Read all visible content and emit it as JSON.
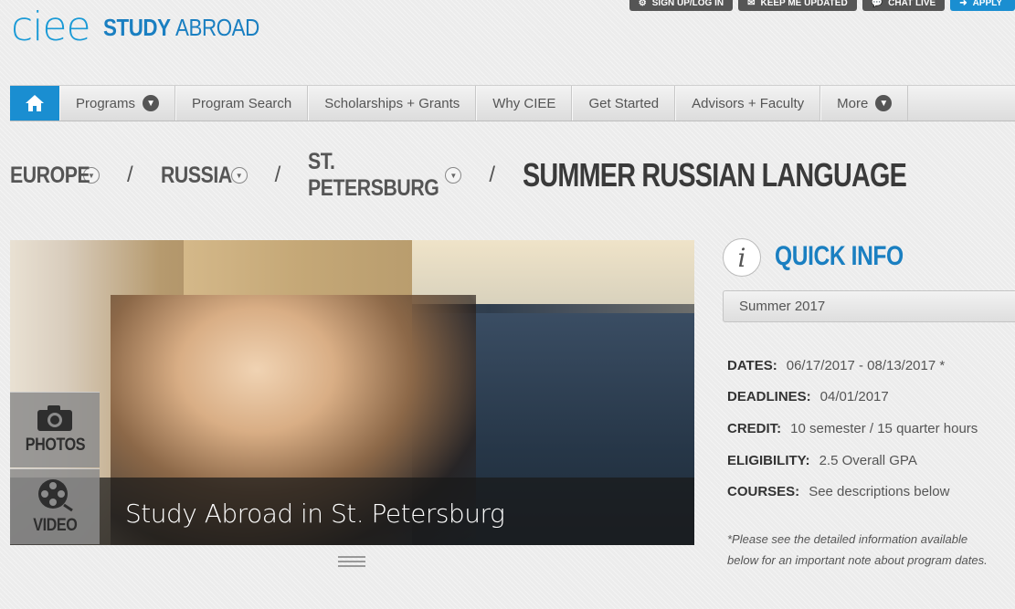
{
  "brand": {
    "logo_mark": "ciee",
    "logo_text_1": "STUDY",
    "logo_text_2": "ABROAD"
  },
  "toplinks": [
    {
      "label": "SIGN UP/LOG IN",
      "icon": "gear-icon"
    },
    {
      "label": "KEEP ME UPDATED",
      "icon": "mail-icon"
    },
    {
      "label": "CHAT LIVE",
      "icon": "chat-icon"
    },
    {
      "label": "APPLY",
      "icon": "arrow-icon"
    }
  ],
  "nav": {
    "home_icon": "home-icon",
    "items": [
      {
        "label": "Programs",
        "has_caret": true
      },
      {
        "label": "Program Search",
        "has_caret": false
      },
      {
        "label": "Scholarships + Grants",
        "has_caret": false
      },
      {
        "label": "Why CIEE",
        "has_caret": false
      },
      {
        "label": "Get Started",
        "has_caret": false
      },
      {
        "label": "Advisors + Faculty",
        "has_caret": false
      },
      {
        "label": "More",
        "has_caret": true
      }
    ]
  },
  "breadcrumb": {
    "region": "EUROPE",
    "country": "RUSSIA",
    "city": "ST. PETERSBURG",
    "separator": "/",
    "current": "SUMMER RUSSIAN LANGUAGE"
  },
  "hero": {
    "caption": "Study Abroad in St. Petersburg",
    "photos_label": "PHOTOS",
    "video_label": "VIDEO"
  },
  "quick_info": {
    "title": "QUICK INFO",
    "term": "Summer 2017",
    "rows": [
      {
        "label": "DATES:",
        "value": "06/17/2017 - 08/13/2017 *"
      },
      {
        "label": "DEADLINES:",
        "value": "04/01/2017"
      },
      {
        "label": "CREDIT:",
        "value": "10 semester / 15 quarter hours"
      },
      {
        "label": "ELIGIBILITY:",
        "value": "2.5 Overall GPA"
      },
      {
        "label": "COURSES:",
        "value": "See descriptions below"
      }
    ],
    "note": "*Please see the detailed information available below for an important note about program dates."
  },
  "colors": {
    "brand_blue": "#1a8ed1",
    "title_blue": "#1a7fc1",
    "dark_button": "#555555"
  }
}
